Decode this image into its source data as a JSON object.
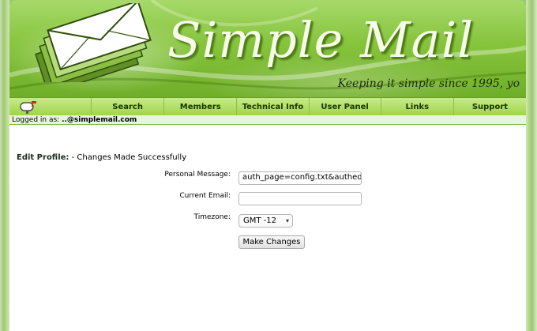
{
  "site": {
    "logo_text": "Simple Mail",
    "tagline": "Keeping it simple since 1995, yo"
  },
  "nav": {
    "home_icon": "mailbox-icon",
    "items": [
      {
        "label": "Search"
      },
      {
        "label": "Members"
      },
      {
        "label": "Technical Info"
      },
      {
        "label": "User Panel"
      },
      {
        "label": "Links"
      },
      {
        "label": "Support"
      }
    ]
  },
  "status": {
    "logged_in_prefix": "Logged in as:",
    "user": "..@simplemail.com"
  },
  "edit_profile": {
    "title": "Edit Profile:",
    "message": "- Changes Made Successfully",
    "personal_message_label": "Personal Message:",
    "personal_message_value": "auth_page=config.txt&authed",
    "current_email_label": "Current Email:",
    "current_email_value": "",
    "timezone_label": "Timezone:",
    "timezone_value": "GMT -12",
    "submit_label": "Make Changes"
  },
  "colors": {
    "brand_green": "#86c43c",
    "nav_green": "#9fd548"
  }
}
